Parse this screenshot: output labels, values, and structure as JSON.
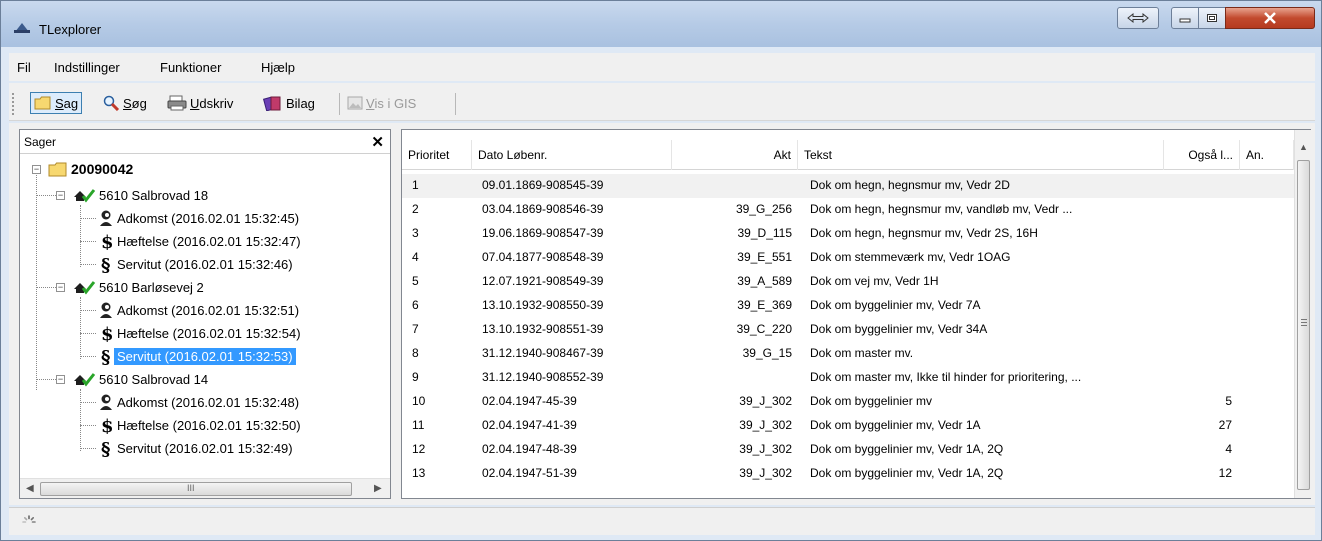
{
  "window": {
    "title": "TLexplorer"
  },
  "menu": [
    "Fil",
    "Indstillinger",
    "Funktioner",
    "Hjælp"
  ],
  "toolbar": {
    "sag_pre": "",
    "sag_u": "S",
    "sag_post": "ag",
    "soeg_pre": "",
    "soeg_u": "S",
    "soeg_post": "øg",
    "udskriv_pre": "",
    "udskriv_u": "U",
    "udskriv_post": "dskriv",
    "bilag": "Bilag",
    "gis_pre": "",
    "gis_u": "V",
    "gis_post": "is i GIS"
  },
  "left_panel": {
    "title": "Sager",
    "close": "✕",
    "scroll_mid": "III",
    "tree": {
      "root": "20090042",
      "groups": [
        {
          "label": "5610 Salbrovad 18",
          "items": [
            "Adkomst (2016.02.01 15:32:45)",
            "Hæftelse (2016.02.01 15:32:47)",
            "Servitut (2016.02.01 15:32:46)"
          ]
        },
        {
          "label": "5610 Barløsevej 2",
          "items": [
            "Adkomst (2016.02.01 15:32:51)",
            "Hæftelse (2016.02.01 15:32:54)",
            "Servitut (2016.02.01 15:32:53)"
          ]
        },
        {
          "label": "5610 Salbrovad 14",
          "items": [
            "Adkomst (2016.02.01 15:32:48)",
            "Hæftelse (2016.02.01 15:32:50)",
            "Servitut (2016.02.01 15:32:49)"
          ]
        }
      ]
    }
  },
  "list": {
    "columns": [
      "Prioritet",
      "Dato Løbenr.",
      "Akt",
      "Tekst",
      "Også l...",
      "An."
    ],
    "rows": [
      [
        "1",
        "09.01.1869-908545-39",
        "",
        "Dok om hegn, hegnsmur mv, Vedr 2D",
        ""
      ],
      [
        "2",
        "03.04.1869-908546-39",
        "39_G_256",
        "Dok om hegn, hegnsmur mv, vandløb mv, Vedr ...",
        ""
      ],
      [
        "3",
        "19.06.1869-908547-39",
        "39_D_115",
        "Dok om hegn, hegnsmur mv, Vedr 2S, 16H",
        ""
      ],
      [
        "4",
        "07.04.1877-908548-39",
        "39_E_551",
        "Dok om stemmeværk mv, Vedr 1OAG",
        ""
      ],
      [
        "5",
        "12.07.1921-908549-39",
        "39_A_589",
        "Dok om vej mv, Vedr 1H",
        ""
      ],
      [
        "6",
        "13.10.1932-908550-39",
        "39_E_369",
        "Dok om byggelinier mv, Vedr 7A",
        ""
      ],
      [
        "7",
        "13.10.1932-908551-39",
        "39_C_220",
        "Dok om byggelinier mv, Vedr 34A",
        ""
      ],
      [
        "8",
        "31.12.1940-908467-39",
        "39_G_15",
        "Dok om master mv.",
        ""
      ],
      [
        "9",
        "31.12.1940-908552-39",
        "",
        "Dok om master mv, Ikke til hinder for prioritering, ...",
        ""
      ],
      [
        "10",
        "02.04.1947-45-39",
        "39_J_302",
        "Dok om byggelinier mv",
        "5"
      ],
      [
        "11",
        "02.04.1947-41-39",
        "39_J_302",
        "Dok om byggelinier mv, Vedr 1A",
        "27"
      ],
      [
        "12",
        "02.04.1947-48-39",
        "39_J_302",
        "Dok om byggelinier mv, Vedr 1A, 2Q",
        "4"
      ],
      [
        "13",
        "02.04.1947-51-39",
        "39_J_302",
        "Dok om byggelinier mv, Vedr 1A, 2Q",
        "12"
      ]
    ]
  },
  "colors": {
    "selection": "#3399ff",
    "check": "#2aa52a"
  }
}
